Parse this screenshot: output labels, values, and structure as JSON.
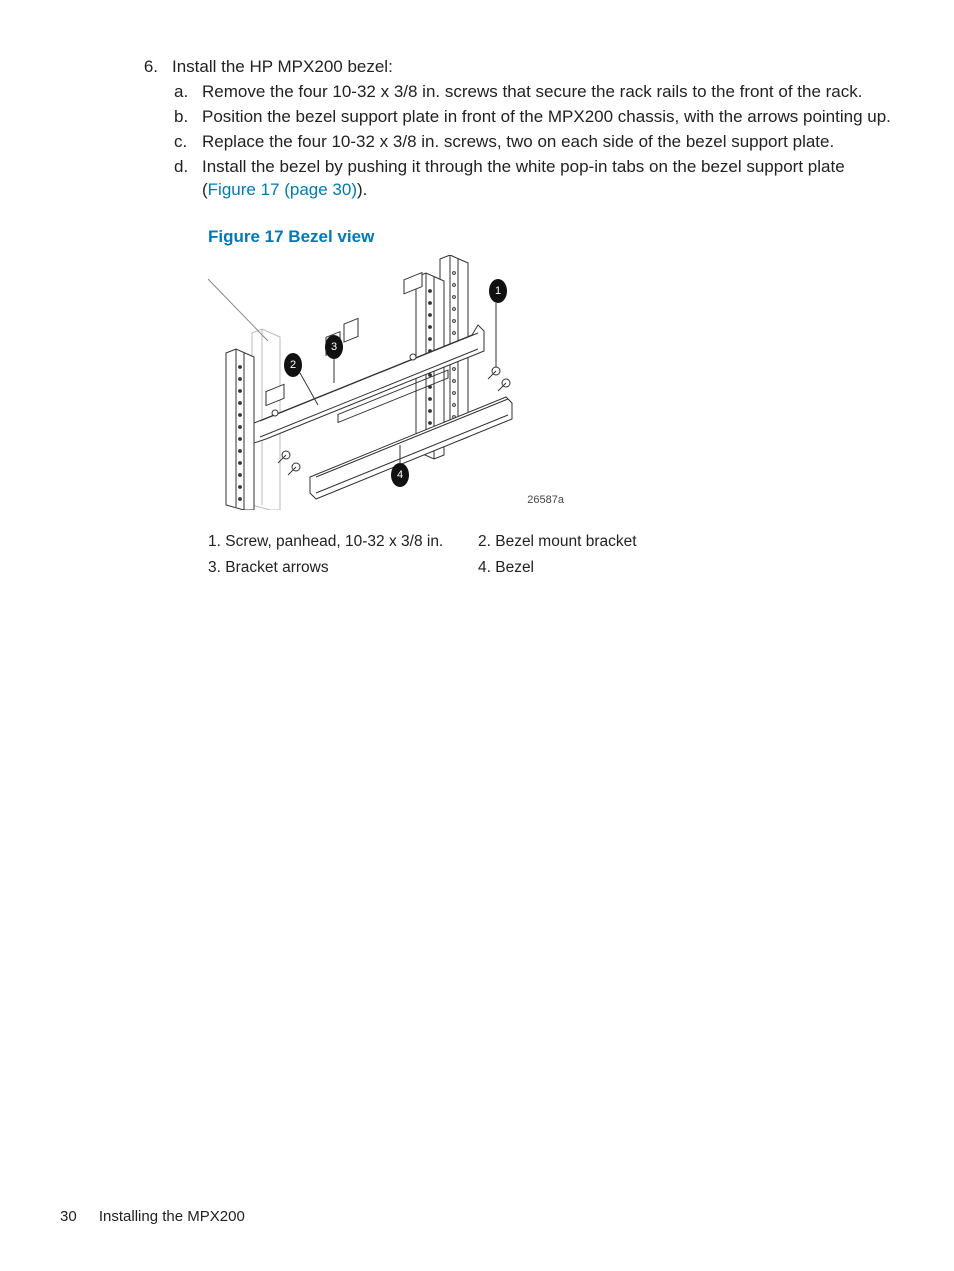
{
  "step": {
    "number": "6.",
    "intro": "Install the HP MPX200 bezel:",
    "items": [
      {
        "marker": "a.",
        "text": "Remove the four 10-32 x 3/8 in. screws that secure the rack rails to the front of the rack."
      },
      {
        "marker": "b.",
        "text": "Position the bezel support plate in front of the MPX200 chassis, with the arrows pointing up."
      },
      {
        "marker": "c.",
        "text": "Replace the four 10-32 x 3/8 in. screws, two on each side of the bezel support plate."
      },
      {
        "marker": "d.",
        "text_pre": "Install the bezel by pushing it through the white pop-in tabs on the bezel support plate (",
        "link": "Figure 17 (page 30)",
        "text_post": ")."
      }
    ]
  },
  "figure": {
    "caption": "Figure 17 Bezel view",
    "id": "26587a",
    "callouts": [
      "1",
      "2",
      "3",
      "4"
    ]
  },
  "legend": {
    "row1": {
      "a": "1. Screw, panhead, 10-32 x 3/8 in.",
      "b": "2. Bezel mount bracket"
    },
    "row2": {
      "a": "3. Bracket arrows",
      "b": "4. Bezel"
    }
  },
  "footer": {
    "page": "30",
    "section": "Installing the MPX200"
  }
}
